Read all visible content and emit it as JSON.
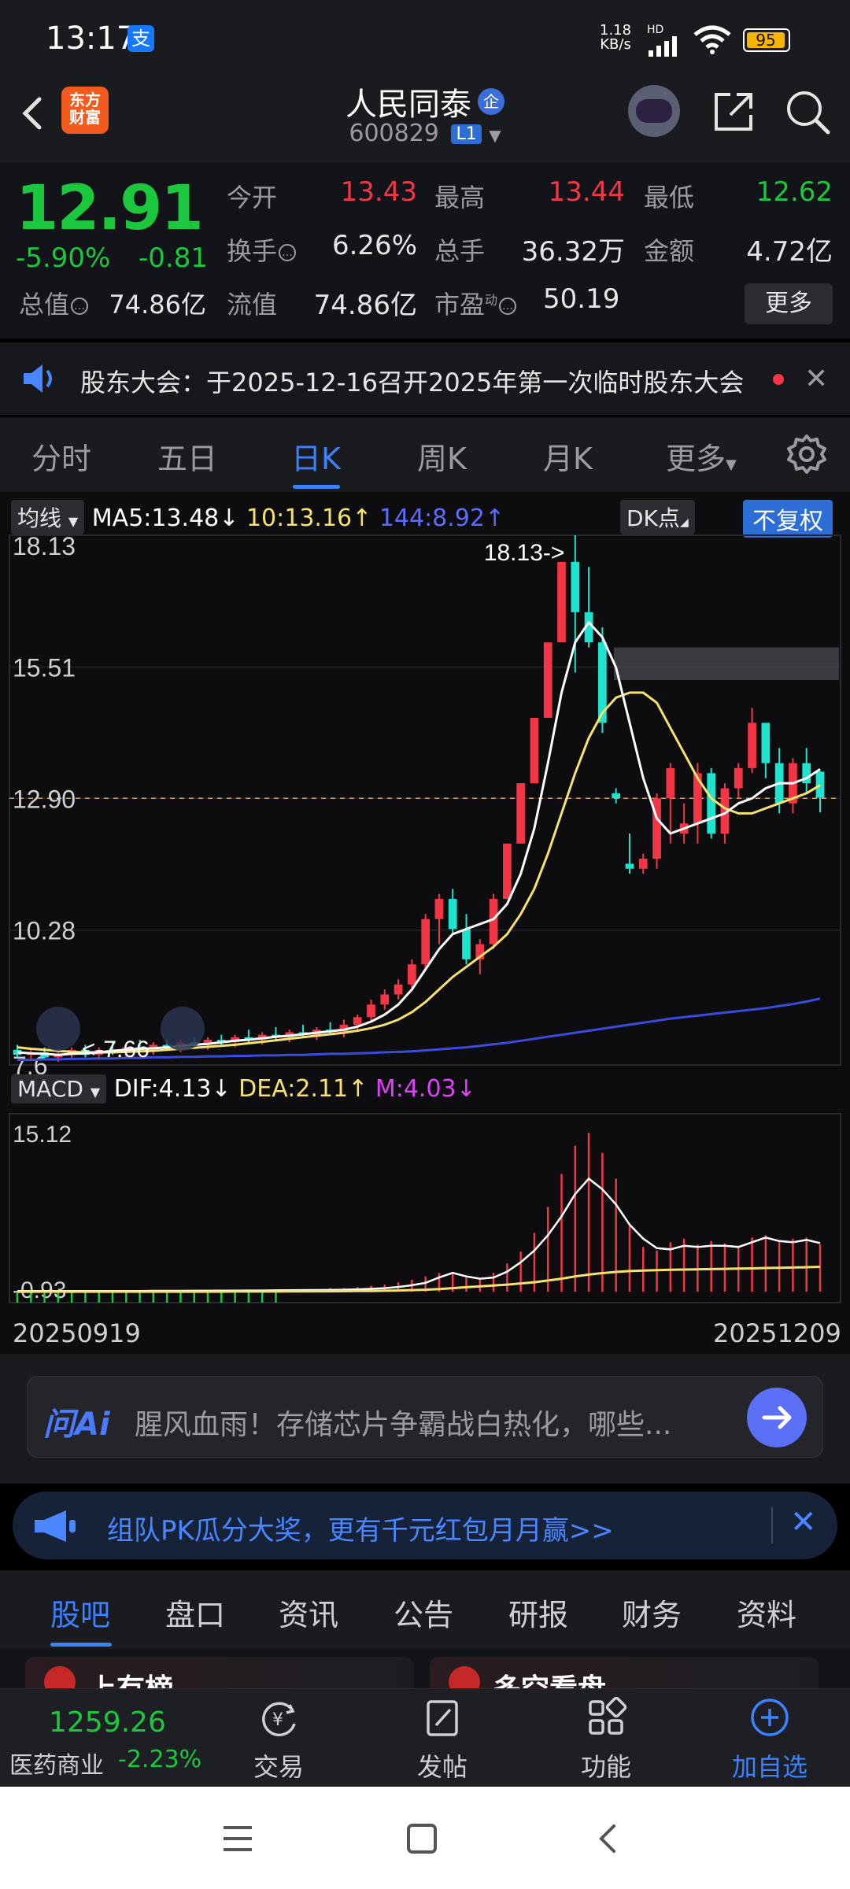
{
  "status_bar": {
    "time": "13:17",
    "alipay_icon_text": "支",
    "net_speed_value": "1.18",
    "net_speed_unit": "KB/s",
    "hd_label": "HD",
    "battery": "95"
  },
  "header": {
    "logo_line1": "东方",
    "logo_line2": "财富",
    "stock_name": "人民同泰",
    "badge": "企",
    "stock_code": "600829",
    "level": "L1"
  },
  "quote": {
    "price": "12.91",
    "change_pct": "-5.90%",
    "change": "-0.81",
    "open_label": "今开",
    "open": "13.43",
    "high_label": "最高",
    "high": "13.44",
    "low_label": "最低",
    "low": "12.62",
    "turnover_label": "换手",
    "turnover": "6.26%",
    "volume_label": "总手",
    "volume": "36.32万",
    "amount_label": "金额",
    "amount": "4.72亿",
    "mktcap_label": "总值",
    "mktcap": "74.86亿",
    "float_label": "流值",
    "float": "74.86亿",
    "pe_label": "市盈",
    "pe_sup": "动",
    "pe": "50.19",
    "more": "更多"
  },
  "notice": {
    "text": "股东大会：于2025-12-16召开2025年第一次临时股东大会"
  },
  "period_tabs": [
    "分时",
    "五日",
    "日K",
    "周K",
    "月K",
    "更多"
  ],
  "period_active": 2,
  "chart_toolbar": {
    "ma_button": "均线",
    "ma5": "MA5:13.48",
    "ma10": "10:13.16",
    "ma144": "144:8.92",
    "dk": "DK点",
    "adjust": "不复权",
    "macd_button": "MACD",
    "dif": "DIF:4.13",
    "dea": "DEA:2.11",
    "m": "M:4.03"
  },
  "colors": {
    "up": "#f23645",
    "down": "#1ee3cf",
    "ma5": "#ffffff",
    "ma10": "#f7e36b",
    "ma144": "#3a4be0",
    "accent": "#3b82ff"
  },
  "chart_data": {
    "type": "candlestick",
    "price_axis_labels": [
      "18.13",
      "15.51",
      "12.90",
      "10.28",
      "7.6"
    ],
    "ylim": [
      7.6,
      18.13
    ],
    "high_marker": "18.13->",
    "low_marker": "<-7.66",
    "current_line": 12.9,
    "date_start": "20250919",
    "date_end": "20251209",
    "candles": [
      {
        "o": 7.9,
        "h": 8.0,
        "l": 7.75,
        "c": 7.8
      },
      {
        "o": 7.8,
        "h": 7.9,
        "l": 7.7,
        "c": 7.85
      },
      {
        "o": 7.85,
        "h": 7.95,
        "l": 7.7,
        "c": 7.75
      },
      {
        "o": 7.75,
        "h": 7.85,
        "l": 7.66,
        "c": 7.8
      },
      {
        "o": 7.8,
        "h": 7.95,
        "l": 7.7,
        "c": 7.9
      },
      {
        "o": 7.9,
        "h": 8.0,
        "l": 7.75,
        "c": 7.8
      },
      {
        "o": 7.8,
        "h": 7.95,
        "l": 7.7,
        "c": 7.9
      },
      {
        "o": 7.9,
        "h": 8.05,
        "l": 7.8,
        "c": 7.85
      },
      {
        "o": 7.85,
        "h": 8.0,
        "l": 7.75,
        "c": 7.95
      },
      {
        "o": 7.95,
        "h": 8.1,
        "l": 7.85,
        "c": 7.9
      },
      {
        "o": 7.9,
        "h": 8.05,
        "l": 7.8,
        "c": 8.0
      },
      {
        "o": 8.0,
        "h": 8.1,
        "l": 7.9,
        "c": 7.95
      },
      {
        "o": 7.95,
        "h": 8.1,
        "l": 7.85,
        "c": 8.05
      },
      {
        "o": 8.05,
        "h": 8.15,
        "l": 7.95,
        "c": 8.0
      },
      {
        "o": 8.0,
        "h": 8.15,
        "l": 7.9,
        "c": 8.1
      },
      {
        "o": 8.1,
        "h": 8.2,
        "l": 8.0,
        "c": 8.05
      },
      {
        "o": 8.05,
        "h": 8.2,
        "l": 7.95,
        "c": 8.15
      },
      {
        "o": 8.15,
        "h": 8.3,
        "l": 8.05,
        "c": 8.1
      },
      {
        "o": 8.1,
        "h": 8.25,
        "l": 8.0,
        "c": 8.2
      },
      {
        "o": 8.2,
        "h": 8.35,
        "l": 8.1,
        "c": 8.15
      },
      {
        "o": 8.15,
        "h": 8.3,
        "l": 8.05,
        "c": 8.25
      },
      {
        "o": 8.25,
        "h": 8.4,
        "l": 8.15,
        "c": 8.2
      },
      {
        "o": 8.2,
        "h": 8.35,
        "l": 8.1,
        "c": 8.3
      },
      {
        "o": 8.3,
        "h": 8.45,
        "l": 8.2,
        "c": 8.25
      },
      {
        "o": 8.25,
        "h": 8.5,
        "l": 8.15,
        "c": 8.4
      },
      {
        "o": 8.4,
        "h": 8.6,
        "l": 8.3,
        "c": 8.55
      },
      {
        "o": 8.55,
        "h": 8.9,
        "l": 8.45,
        "c": 8.8
      },
      {
        "o": 8.8,
        "h": 9.1,
        "l": 8.7,
        "c": 9.0
      },
      {
        "o": 9.0,
        "h": 9.3,
        "l": 8.9,
        "c": 9.2
      },
      {
        "o": 9.2,
        "h": 9.7,
        "l": 9.1,
        "c": 9.6
      },
      {
        "o": 9.6,
        "h": 10.6,
        "l": 9.5,
        "c": 10.5
      },
      {
        "o": 10.5,
        "h": 11.0,
        "l": 10.0,
        "c": 10.9
      },
      {
        "o": 10.9,
        "h": 11.1,
        "l": 10.2,
        "c": 10.3
      },
      {
        "o": 10.3,
        "h": 10.6,
        "l": 9.6,
        "c": 9.7
      },
      {
        "o": 9.7,
        "h": 10.1,
        "l": 9.4,
        "c": 10.0
      },
      {
        "o": 10.0,
        "h": 11.0,
        "l": 9.9,
        "c": 10.9
      },
      {
        "o": 10.9,
        "h": 12.0,
        "l": 10.9,
        "c": 12.0
      },
      {
        "o": 12.0,
        "h": 13.2,
        "l": 12.0,
        "c": 13.2
      },
      {
        "o": 13.2,
        "h": 14.5,
        "l": 13.2,
        "c": 14.5
      },
      {
        "o": 14.5,
        "h": 16.0,
        "l": 14.5,
        "c": 16.0
      },
      {
        "o": 16.0,
        "h": 17.6,
        "l": 16.0,
        "c": 17.6
      },
      {
        "o": 17.6,
        "h": 18.13,
        "l": 15.4,
        "c": 16.6
      },
      {
        "o": 16.6,
        "h": 17.5,
        "l": 15.9,
        "c": 16.0
      },
      {
        "o": 16.0,
        "h": 16.3,
        "l": 14.2,
        "c": 14.4
      },
      {
        "o": 13.0,
        "h": 13.1,
        "l": 12.8,
        "c": 12.9
      },
      {
        "o": 11.6,
        "h": 12.2,
        "l": 11.4,
        "c": 11.5
      },
      {
        "o": 11.5,
        "h": 11.8,
        "l": 11.4,
        "c": 11.7
      },
      {
        "o": 11.7,
        "h": 13.0,
        "l": 11.5,
        "c": 12.9
      },
      {
        "o": 12.9,
        "h": 13.6,
        "l": 12.0,
        "c": 13.5
      },
      {
        "o": 12.2,
        "h": 12.8,
        "l": 12.0,
        "c": 12.4
      },
      {
        "o": 12.4,
        "h": 13.6,
        "l": 12.0,
        "c": 13.4
      },
      {
        "o": 13.4,
        "h": 13.5,
        "l": 12.1,
        "c": 12.2
      },
      {
        "o": 12.2,
        "h": 13.2,
        "l": 12.0,
        "c": 13.1
      },
      {
        "o": 13.1,
        "h": 13.6,
        "l": 12.9,
        "c": 13.5
      },
      {
        "o": 13.5,
        "h": 14.7,
        "l": 13.4,
        "c": 14.4
      },
      {
        "o": 14.4,
        "h": 14.4,
        "l": 13.3,
        "c": 13.6
      },
      {
        "o": 13.6,
        "h": 13.9,
        "l": 12.6,
        "c": 12.8
      },
      {
        "o": 12.8,
        "h": 13.7,
        "l": 12.6,
        "c": 13.6
      },
      {
        "o": 13.6,
        "h": 13.9,
        "l": 13.0,
        "c": 13.2
      },
      {
        "o": 13.43,
        "h": 13.44,
        "l": 12.62,
        "c": 12.91
      }
    ],
    "ma5": [
      7.85,
      7.83,
      7.82,
      7.8,
      7.82,
      7.83,
      7.85,
      7.88,
      7.9,
      7.92,
      7.93,
      7.95,
      7.98,
      8.0,
      8.02,
      8.05,
      8.08,
      8.1,
      8.13,
      8.16,
      8.18,
      8.21,
      8.24,
      8.27,
      8.3,
      8.36,
      8.46,
      8.6,
      8.8,
      9.1,
      9.5,
      9.9,
      10.2,
      10.3,
      10.4,
      10.5,
      10.8,
      11.4,
      12.3,
      13.6,
      15.0,
      16.0,
      16.4,
      16.1,
      15.5,
      14.4,
      13.3,
      12.5,
      12.2,
      12.3,
      12.4,
      12.5,
      12.6,
      12.8,
      12.9,
      13.1,
      13.2,
      13.2,
      13.3,
      13.48
    ],
    "ma10": [
      7.95,
      7.92,
      7.9,
      7.88,
      7.86,
      7.85,
      7.85,
      7.85,
      7.86,
      7.87,
      7.88,
      7.9,
      7.92,
      7.94,
      7.96,
      7.98,
      8.0,
      8.03,
      8.06,
      8.09,
      8.12,
      8.15,
      8.18,
      8.21,
      8.24,
      8.28,
      8.33,
      8.4,
      8.5,
      8.65,
      8.85,
      9.1,
      9.35,
      9.55,
      9.75,
      9.95,
      10.2,
      10.6,
      11.1,
      11.8,
      12.6,
      13.4,
      14.1,
      14.6,
      14.9,
      15.0,
      15.0,
      14.8,
      14.3,
      13.8,
      13.3,
      12.9,
      12.7,
      12.6,
      12.6,
      12.7,
      12.8,
      12.9,
      13.0,
      13.16
    ],
    "ma144": [
      7.7,
      7.7,
      7.71,
      7.71,
      7.72,
      7.72,
      7.73,
      7.73,
      7.74,
      7.74,
      7.75,
      7.75,
      7.76,
      7.76,
      7.77,
      7.77,
      7.78,
      7.78,
      7.79,
      7.79,
      7.8,
      7.8,
      7.81,
      7.82,
      7.82,
      7.83,
      7.84,
      7.85,
      7.86,
      7.87,
      7.89,
      7.91,
      7.93,
      7.95,
      7.98,
      8.01,
      8.04,
      8.08,
      8.12,
      8.16,
      8.2,
      8.24,
      8.28,
      8.32,
      8.36,
      8.4,
      8.44,
      8.48,
      8.52,
      8.55,
      8.58,
      8.61,
      8.64,
      8.67,
      8.7,
      8.73,
      8.77,
      8.81,
      8.86,
      8.92
    ],
    "macd_axis_labels": [
      "15.12",
      "-0.93"
    ],
    "macd_ylim": [
      -0.93,
      15.12
    ],
    "macd_hist": [
      0.1,
      0.1,
      0.1,
      0.1,
      0.1,
      0.1,
      0.1,
      0.1,
      0.1,
      0.1,
      0.1,
      0.1,
      0.1,
      0.1,
      0.1,
      0.1,
      0.1,
      0.1,
      0.1,
      0.1,
      0.2,
      0.2,
      0.2,
      0.3,
      0.3,
      0.4,
      0.5,
      0.6,
      0.8,
      1.0,
      1.3,
      1.6,
      1.5,
      1.2,
      1.1,
      1.6,
      2.4,
      3.4,
      5.0,
      7.2,
      10.0,
      12.4,
      13.5,
      11.8,
      9.6,
      5.6,
      3.8,
      3.5,
      4.2,
      4.5,
      4.0,
      4.3,
      4.1,
      3.9,
      4.6,
      4.8,
      4.2,
      4.5,
      4.6,
      4.03
    ],
    "macd_dif": [
      0.05,
      0.05,
      0.05,
      0.05,
      0.05,
      0.05,
      0.06,
      0.06,
      0.06,
      0.06,
      0.07,
      0.07,
      0.07,
      0.08,
      0.08,
      0.09,
      0.09,
      0.1,
      0.1,
      0.11,
      0.12,
      0.13,
      0.14,
      0.15,
      0.17,
      0.2,
      0.24,
      0.3,
      0.4,
      0.55,
      0.75,
      1.2,
      1.6,
      1.3,
      1.1,
      1.2,
      1.7,
      2.5,
      3.5,
      4.8,
      6.4,
      8.3,
      9.6,
      8.7,
      7.4,
      5.7,
      4.5,
      3.7,
      3.6,
      3.9,
      3.8,
      3.9,
      3.9,
      3.8,
      4.2,
      4.6,
      4.3,
      4.2,
      4.4,
      4.13
    ],
    "macd_dea": [
      0.0,
      0.0,
      0.0,
      0.0,
      0.0,
      0.0,
      0.0,
      0.0,
      0.0,
      0.0,
      0.0,
      0.0,
      0.0,
      0.0,
      0.0,
      0.0,
      0.01,
      0.01,
      0.01,
      0.01,
      0.02,
      0.02,
      0.03,
      0.03,
      0.04,
      0.05,
      0.06,
      0.08,
      0.1,
      0.13,
      0.17,
      0.22,
      0.3,
      0.38,
      0.45,
      0.52,
      0.6,
      0.7,
      0.8,
      0.95,
      1.1,
      1.3,
      1.45,
      1.58,
      1.68,
      1.75,
      1.8,
      1.83,
      1.86,
      1.88,
      1.9,
      1.92,
      1.94,
      1.96,
      1.98,
      2.01,
      2.03,
      2.05,
      2.08,
      2.11
    ]
  },
  "ai_bar": {
    "logo": "问Ai",
    "text": "腥风血雨！存储芯片争霸战白热化，哪些..."
  },
  "promo": {
    "text": "组队PK瓜分大奖，更有千元红包月月赢>>"
  },
  "bottom_tabs": [
    "股吧",
    "盘口",
    "资讯",
    "公告",
    "研报",
    "财务",
    "资料"
  ],
  "bottom_tab_active": 0,
  "peek_cards": [
    "上有榜",
    "多空看盘"
  ],
  "bottom_nav": {
    "index_value": "1259.26",
    "index_name": "医药商业",
    "index_pct": "-2.23%",
    "items": [
      "交易",
      "发帖",
      "功能",
      "加自选"
    ]
  }
}
